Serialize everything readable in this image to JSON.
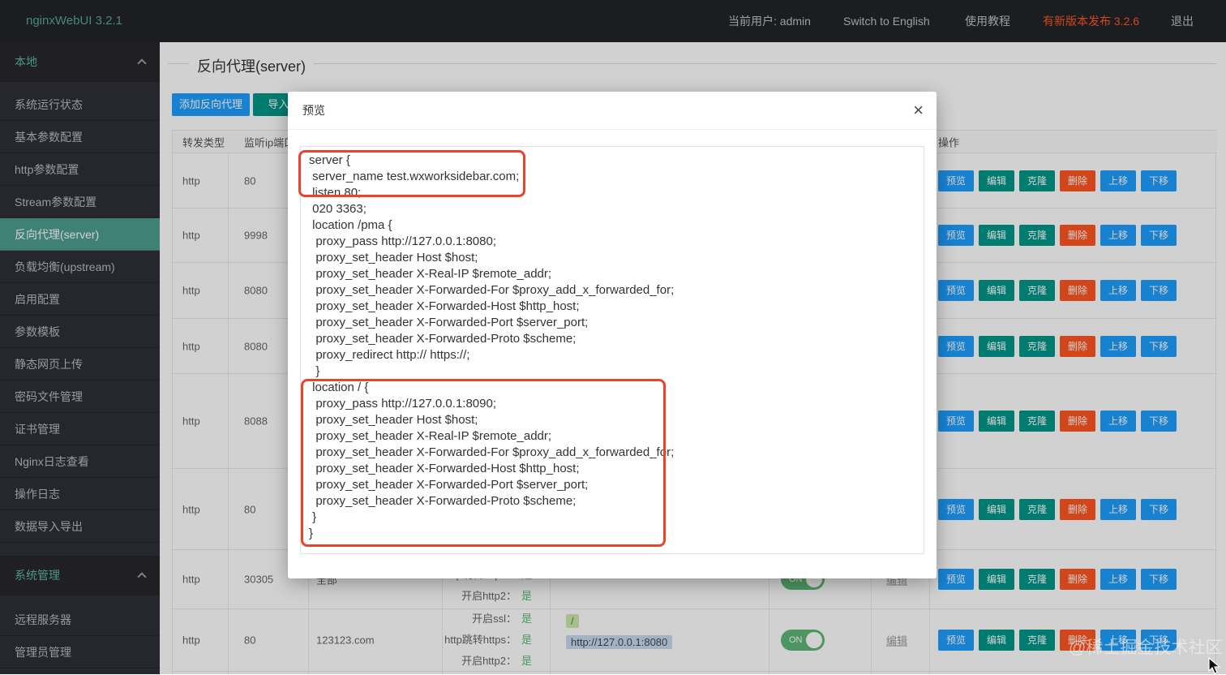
{
  "topbar": {
    "logo": "nginxWebUI 3.2.1",
    "current_user": "当前用户: admin",
    "switch_lang": "Switch to English",
    "tutorial": "使用教程",
    "new_version": "有新版本发布 3.2.6",
    "logout": "退出"
  },
  "sidebar": {
    "section_local": "本地",
    "local_items": [
      "系统运行状态",
      "基本参数配置",
      "http参数配置",
      "Stream参数配置",
      "反向代理(server)",
      "负载均衡(upstream)",
      "启用配置",
      "参数模板",
      "静态网页上传",
      "密码文件管理",
      "证书管理",
      "Nginx日志查看",
      "操作日志",
      "数据导入导出"
    ],
    "active_item": "反向代理(server)",
    "section_system": "系统管理",
    "system_items": [
      "远程服务器",
      "管理员管理"
    ]
  },
  "page": {
    "title": "反向代理(server)"
  },
  "toolbar": {
    "add_button": "添加反向代理",
    "import_button": "导入nginx.conf"
  },
  "table": {
    "headers": {
      "type": "转发类型",
      "listen": "监听ip端口",
      "actions": "操作"
    },
    "actions": [
      "预览",
      "编辑",
      "克隆",
      "删除",
      "上移",
      "下移"
    ],
    "toggle_on": "ON",
    "edit_link": "编辑",
    "rows": [
      {
        "type": "http",
        "port": "80"
      },
      {
        "type": "http",
        "port": "9998"
      },
      {
        "type": "http",
        "port": "8080"
      },
      {
        "type": "http",
        "port": "8080"
      },
      {
        "type": "http",
        "port": "8088"
      },
      {
        "type": "http",
        "port": "80"
      },
      {
        "type": "http",
        "port": "30305",
        "domain": "全部",
        "flags": [
          {
            "label": "http跳转https：",
            "value": "是"
          },
          {
            "label": "开启http2：",
            "value": "是"
          }
        ]
      },
      {
        "type": "http",
        "port": "80",
        "domain": "123123.com",
        "flags": [
          {
            "label": "开启ssl：",
            "value": "是"
          },
          {
            "label": "http跳转https：",
            "value": "是"
          },
          {
            "label": "开启http2：",
            "value": "是"
          }
        ],
        "locations": [
          "/",
          "http://127.0.0.1:8080"
        ]
      }
    ]
  },
  "modal": {
    "title": "预览",
    "close": "×",
    "code": "server {\n server_name test.wxworksidebar.com;\n listen 80;\n 020 3363;\n location /pma {\n  proxy_pass http://127.0.0.1:8080;\n  proxy_set_header Host $host;\n  proxy_set_header X-Real-IP $remote_addr;\n  proxy_set_header X-Forwarded-For $proxy_add_x_forwarded_for;\n  proxy_set_header X-Forwarded-Host $http_host;\n  proxy_set_header X-Forwarded-Port $server_port;\n  proxy_set_header X-Forwarded-Proto $scheme;\n  proxy_redirect http:// https://;\n  }\n location / {\n  proxy_pass http://127.0.0.1:8090;\n  proxy_set_header Host $host;\n  proxy_set_header X-Real-IP $remote_addr;\n  proxy_set_header X-Forwarded-For $proxy_add_x_forwarded_for;\n  proxy_set_header X-Forwarded-Host $http_host;\n  proxy_set_header X-Forwarded-Port $server_port;\n  proxy_set_header X-Forwarded-Proto $scheme;\n }\n}"
  },
  "watermark": "@稀土掘金技术社区",
  "colors": {
    "accent_teal": "#5fb8a8",
    "active_sidebar": "#4e9e8e",
    "blue": "#1e9fff",
    "green": "#009688",
    "red": "#ff5722",
    "toggle_green": "#5fb878",
    "annotation_red": "#e8432c"
  }
}
